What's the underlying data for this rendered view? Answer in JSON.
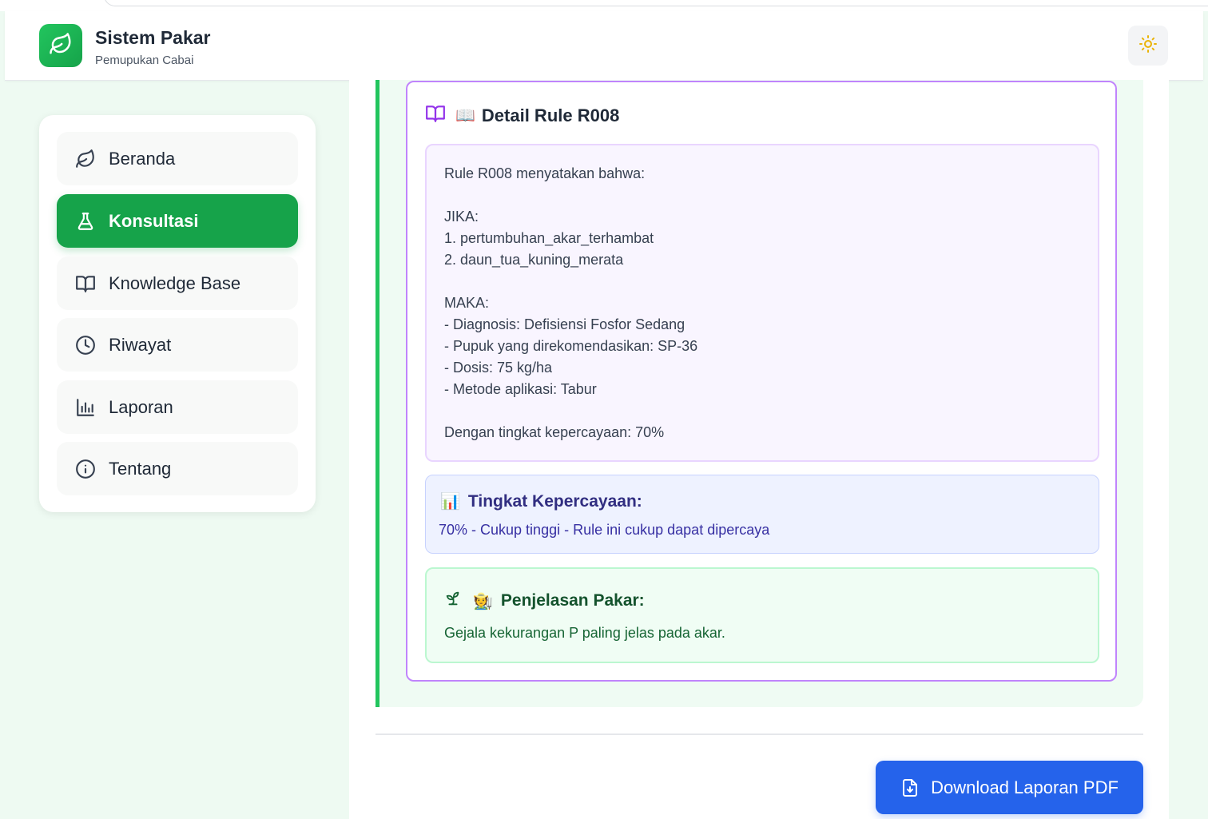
{
  "header": {
    "title": "Sistem Pakar",
    "subtitle": "Pemupukan Cabai",
    "logo_icon": "leaf-icon",
    "theme_toggle_icon": "sun-icon"
  },
  "sidebar": {
    "items": [
      {
        "label": "Beranda",
        "icon": "leaf-icon",
        "active": false
      },
      {
        "label": "Konsultasi",
        "icon": "flask-icon",
        "active": true
      },
      {
        "label": "Knowledge Base",
        "icon": "book-icon",
        "active": false
      },
      {
        "label": "Riwayat",
        "icon": "clock-icon",
        "active": false
      },
      {
        "label": "Laporan",
        "icon": "bar-chart-icon",
        "active": false
      },
      {
        "label": "Tentang",
        "icon": "info-icon",
        "active": false
      }
    ]
  },
  "rule_detail": {
    "emoji": "📖",
    "title": "Detail Rule R008",
    "lines": [
      "Rule R008 menyatakan bahwa:",
      "",
      "JIKA:",
      "1. pertumbuhan_akar_terhambat",
      "2. daun_tua_kuning_merata",
      "",
      "MAKA:",
      "- Diagnosis: Defisiensi Fosfor Sedang",
      "- Pupuk yang direkomendasikan: SP-36",
      "- Dosis: 75 kg/ha",
      "- Metode aplikasi: Tabur",
      "",
      "Dengan tingkat kepercayaan: 70%"
    ]
  },
  "confidence": {
    "emoji": "📊",
    "title": "Tingkat Kepercayaan:",
    "text": "70% - Cukup tinggi - Rule ini cukup dapat dipercaya"
  },
  "expert": {
    "emoji": "🧑‍🌾",
    "title": "Penjelasan Pakar:",
    "text": "Gejala kekurangan P paling jelas pada akar."
  },
  "actions": {
    "download_label": "Download Laporan PDF"
  },
  "colors": {
    "primary_green": "#16a34a",
    "accent_purple": "#c084fc",
    "accent_blue": "#2563eb"
  }
}
